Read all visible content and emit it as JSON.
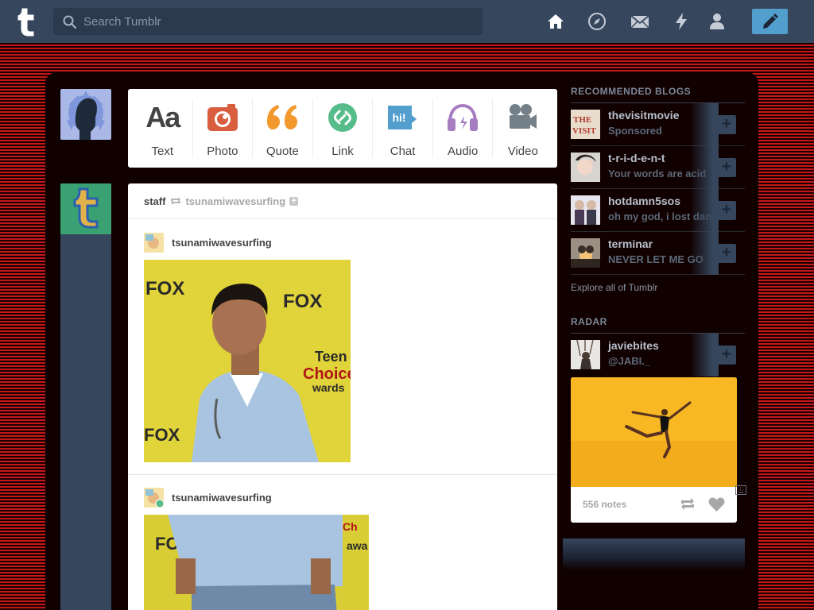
{
  "search": {
    "placeholder": "Search Tumblr"
  },
  "nav": {
    "icons": [
      "home-icon",
      "compass-icon",
      "mail-icon",
      "lightning-icon",
      "account-icon"
    ],
    "compose_icon": "pencil-icon"
  },
  "post_types": [
    {
      "label": "Text",
      "icon_text": "Aa",
      "color": "#444444"
    },
    {
      "label": "Photo",
      "color": "#d95e40"
    },
    {
      "label": "Quote",
      "color": "#f2992e"
    },
    {
      "label": "Link",
      "color": "#56bc8a"
    },
    {
      "label": "Chat",
      "icon_text": "hi!",
      "color": "#529ecc"
    },
    {
      "label": "Audio",
      "color": "#a77dc2"
    },
    {
      "label": "Video",
      "color": "#748089"
    }
  ],
  "post": {
    "author": "staff",
    "source": "tsunamiwavesurfing",
    "reblogs": [
      {
        "name": "tsunamiwavesurfing"
      },
      {
        "name": "tsunamiwavesurfing"
      }
    ]
  },
  "recommended": {
    "heading": "RECOMMENDED BLOGS",
    "items": [
      {
        "name": "thevisitmovie",
        "desc": "Sponsored"
      },
      {
        "name": "t-r-i-d-e-n-t",
        "desc": "Your words are acid"
      },
      {
        "name": "hotdamn5sos",
        "desc": "oh my god, i lost dan"
      },
      {
        "name": "terminar",
        "desc": "NEVER LET ME GO"
      }
    ],
    "explore": "Explore all of Tumblr"
  },
  "radar": {
    "heading": "RADAR",
    "blog": {
      "name": "javiebites",
      "desc": "@JABI._"
    },
    "notes": "556 notes"
  },
  "colors": {
    "topbar": "#36465d",
    "accent": "#529ecc",
    "background_stripes": "#c41818"
  }
}
